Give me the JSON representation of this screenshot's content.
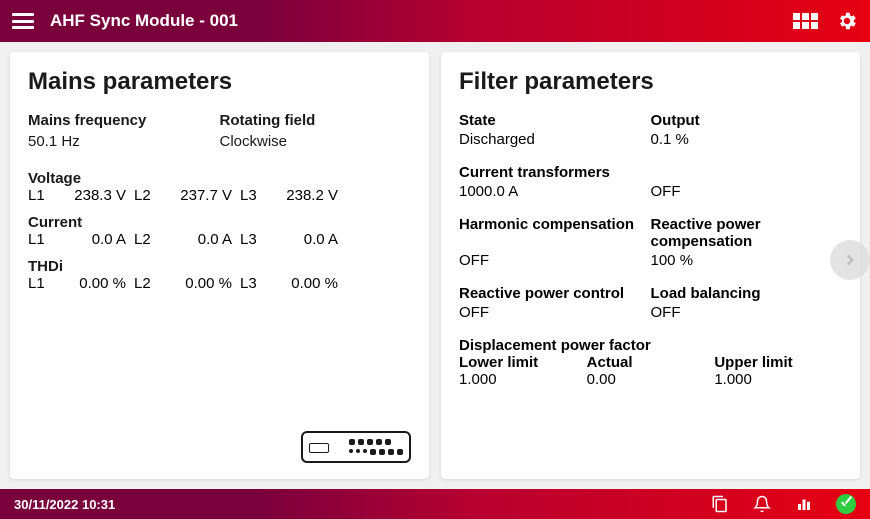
{
  "header": {
    "title": "AHF Sync Module - 001"
  },
  "mains": {
    "title": "Mains parameters",
    "frequency_label": "Mains frequency",
    "frequency_value": "50.1 Hz",
    "rotating_label": "Rotating field",
    "rotating_value": "Clockwise",
    "voltage_label": "Voltage",
    "voltage": {
      "l1": "238.3 V",
      "l2": "237.7 V",
      "l3": "238.2 V"
    },
    "current_label": "Current",
    "current": {
      "l1": "0.0 A",
      "l2": "0.0 A",
      "l3": "0.0 A"
    },
    "thdi_label": "THDi",
    "thdi": {
      "l1": "0.00 %",
      "l2": "0.00 %",
      "l3": "0.00 %"
    },
    "phase_labels": {
      "l1": "L1",
      "l2": "L2",
      "l3": "L3"
    }
  },
  "filter": {
    "title": "Filter parameters",
    "state_label": "State",
    "state_value": "Discharged",
    "output_label": "Output",
    "output_value": "0.1 %",
    "ct_label": "Current transformers",
    "ct_value": "1000.0 A",
    "ct_status": "OFF",
    "harmonic_label": "Harmonic compensation",
    "harmonic_value": "OFF",
    "reactive_comp_label": "Reactive power compensation",
    "reactive_comp_value": "100 %",
    "reactive_ctrl_label": "Reactive power control",
    "reactive_ctrl_value": "OFF",
    "load_bal_label": "Load balancing",
    "load_bal_value": "OFF",
    "dpf_label": "Displacement power factor",
    "dpf_lower_label": "Lower limit",
    "dpf_lower_value": "1.000",
    "dpf_actual_label": "Actual",
    "dpf_actual_value": "0.00",
    "dpf_upper_label": "Upper limit",
    "dpf_upper_value": "1.000"
  },
  "footer": {
    "timestamp": "30/11/2022 10:31"
  }
}
